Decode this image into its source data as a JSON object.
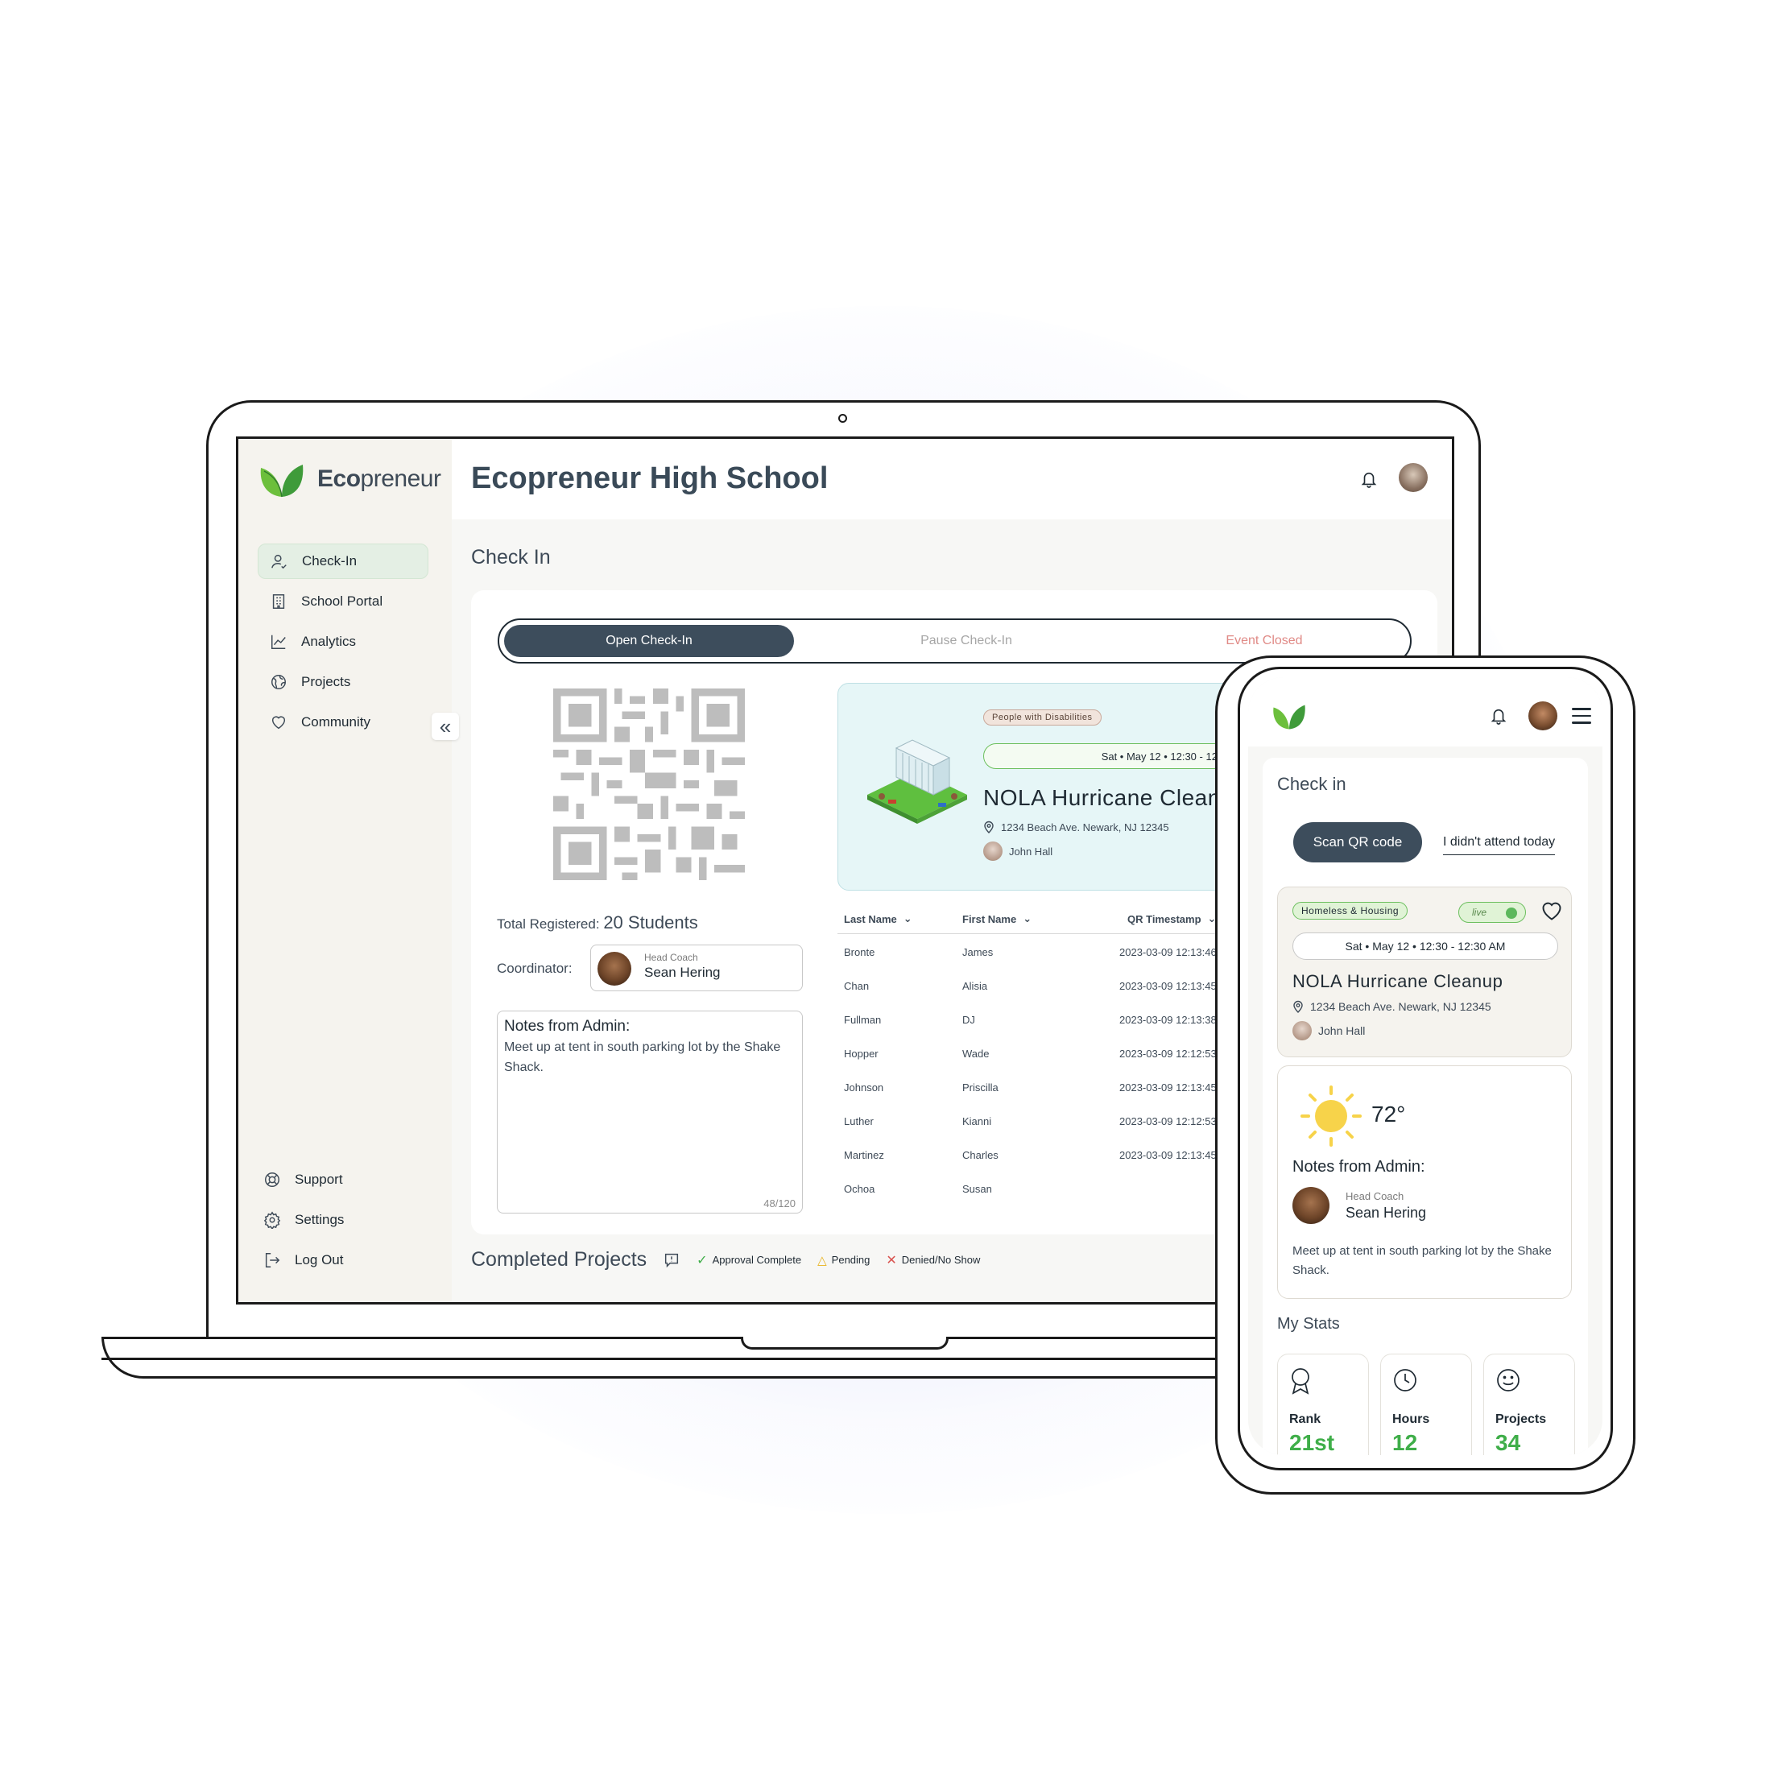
{
  "brand": {
    "name_bold": "Eco",
    "name_rest": "preneur"
  },
  "desktop": {
    "sidebar": {
      "items": [
        {
          "label": "Check-In",
          "icon": "user-check-icon"
        },
        {
          "label": "School Portal",
          "icon": "building-icon"
        },
        {
          "label": "Analytics",
          "icon": "chart-line-icon"
        },
        {
          "label": "Projects",
          "icon": "globe-icon"
        },
        {
          "label": "Community",
          "icon": "heart-icon"
        }
      ],
      "bottom_items": [
        {
          "label": "Support",
          "icon": "lifebuoy-icon"
        },
        {
          "label": "Settings",
          "icon": "gear-icon"
        },
        {
          "label": "Log Out",
          "icon": "logout-icon"
        }
      ]
    },
    "header": {
      "title": "Ecopreneur High School"
    },
    "section_title": "Check In",
    "segmented": {
      "open": "Open Check-In",
      "pause": "Pause Check-In",
      "closed": "Event Closed"
    },
    "total_registered_label": "Total Registered:",
    "total_registered_value": "20 Students",
    "coordinator": {
      "label": "Coordinator:",
      "role": "Head Coach",
      "name": "Sean Hering"
    },
    "notes": {
      "title": "Notes from Admin:",
      "body": "Meet up at tent in south parking lot by the Shake Shack.",
      "count": "48/120"
    },
    "event": {
      "tag": "People with Disabilities",
      "date": "Sat • May 12 • 12:30 - 12:30",
      "name": "NOLA Hurricane Cleanup",
      "address": "1234 Beach Ave. Newark, NJ 12345",
      "host": "John Hall"
    },
    "table": {
      "headers": [
        "Last Name",
        "First Name",
        "QR Timestamp"
      ],
      "rows": [
        {
          "last": "Bronte",
          "first": "James",
          "ts": "2023-03-09 12:13:46"
        },
        {
          "last": "Chan",
          "first": "Alisia",
          "ts": "2023-03-09 12:13:45"
        },
        {
          "last": "Fullman",
          "first": "DJ",
          "ts": "2023-03-09 12:13:38"
        },
        {
          "last": "Hopper",
          "first": "Wade",
          "ts": "2023-03-09 12:12:53"
        },
        {
          "last": "Johnson",
          "first": "Priscilla",
          "ts": "2023-03-09 12:13:45"
        },
        {
          "last": "Luther",
          "first": "Kianni",
          "ts": "2023-03-09 12:12:53"
        },
        {
          "last": "Martinez",
          "first": "Charles",
          "ts": "2023-03-09 12:13:45"
        },
        {
          "last": "Ochoa",
          "first": "Susan",
          "ts": ""
        }
      ]
    },
    "completed": {
      "title": "Completed Projects",
      "legend": {
        "approved": "Approval Complete",
        "pending": "Pending",
        "denied": "Denied/No Show"
      }
    }
  },
  "mobile": {
    "section_title": "Check in",
    "scan_label": "Scan QR code",
    "didnt_attend": "I didn't attend today",
    "event": {
      "tag": "Homeless & Housing",
      "live": "live",
      "date": "Sat • May 12 • 12:30 - 12:30 AM",
      "name": "NOLA Hurricane Cleanup",
      "address": "1234 Beach Ave. Newark, NJ 12345",
      "host": "John Hall"
    },
    "weather": {
      "temp": "72°"
    },
    "notes": {
      "title": "Notes from Admin:",
      "role": "Head Coach",
      "name": "Sean Hering",
      "body": "Meet up at tent in south parking lot by the Shake Shack."
    },
    "stats": {
      "title": "My Stats",
      "items": [
        {
          "label": "Rank",
          "value": "21st",
          "icon": "award-icon"
        },
        {
          "label": "Hours",
          "value": "12",
          "icon": "clock-icon"
        },
        {
          "label": "Projects",
          "value": "34",
          "icon": "smile-icon"
        }
      ]
    }
  },
  "colors": {
    "accent_dark": "#3d4d5c",
    "green": "#3fae49",
    "live_green": "#5cb85c",
    "danger": "#e08a86"
  }
}
